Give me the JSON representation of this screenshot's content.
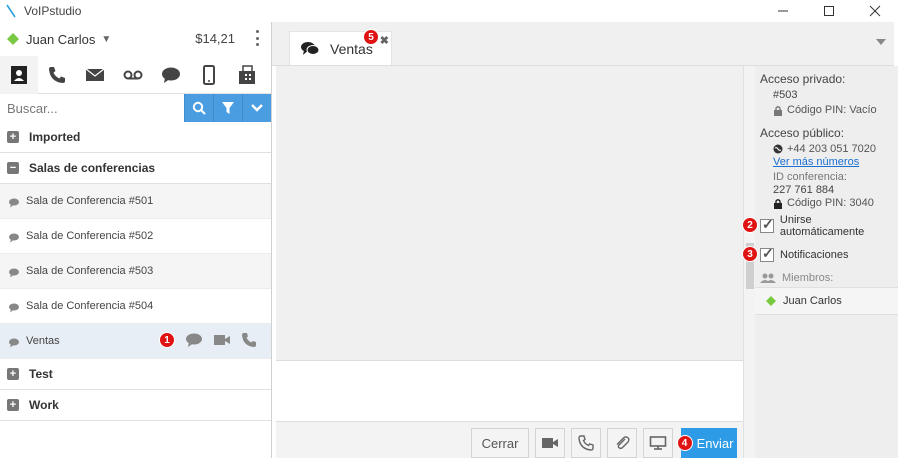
{
  "window": {
    "title": "VoIPstudio"
  },
  "user": {
    "name": "Juan Carlos",
    "balance": "$14,21",
    "status_color": "#7ac943"
  },
  "nav_tabs": [
    {
      "name": "contacts-icon"
    },
    {
      "name": "phone-icon"
    },
    {
      "name": "email-icon"
    },
    {
      "name": "voicemail-icon"
    },
    {
      "name": "chat-icon"
    },
    {
      "name": "mobile-icon"
    },
    {
      "name": "fax-icon"
    }
  ],
  "search": {
    "placeholder": "Buscar..."
  },
  "groups": {
    "imported": {
      "sign": "+",
      "label": "Imported"
    },
    "salas": {
      "sign": "−",
      "label": "Salas de conferencias"
    },
    "test": {
      "sign": "+",
      "label": "Test"
    },
    "work": {
      "sign": "+",
      "label": "Work"
    }
  },
  "rooms": [
    {
      "label": "Sala de Conferencia #501"
    },
    {
      "label": "Sala de Conferencia #502"
    },
    {
      "label": "Sala de Conferencia #503"
    },
    {
      "label": "Sala de Conferencia #504"
    },
    {
      "label": "Ventas"
    }
  ],
  "badges": {
    "b1": "1",
    "b2": "2",
    "b3": "3",
    "b4": "4",
    "b5": "5"
  },
  "chat": {
    "tab_label": "Ventas",
    "close": "✖"
  },
  "actions": {
    "cancel_label": "Cerrar",
    "send_label": "Enviar"
  },
  "details": {
    "private_head": "Acceso privado:",
    "private_ext": "#503",
    "private_pin": "Código PIN: Vacío",
    "public_head": "Acceso público:",
    "public_number": "+44 203 051 7020",
    "more_numbers": "Ver más números",
    "conf_id_label": "ID conferencia:",
    "conf_id": "227 761 884",
    "public_pin": "Código PIN: 3040",
    "auto_join": "Unirse automáticamente",
    "notifications": "Notificaciones",
    "members_head": "Miembros:",
    "members": [
      {
        "name": "Juan Carlos"
      }
    ]
  },
  "colors": {
    "accent": "#4a9de0",
    "send": "#2d9be6",
    "badge": "#e01313"
  }
}
